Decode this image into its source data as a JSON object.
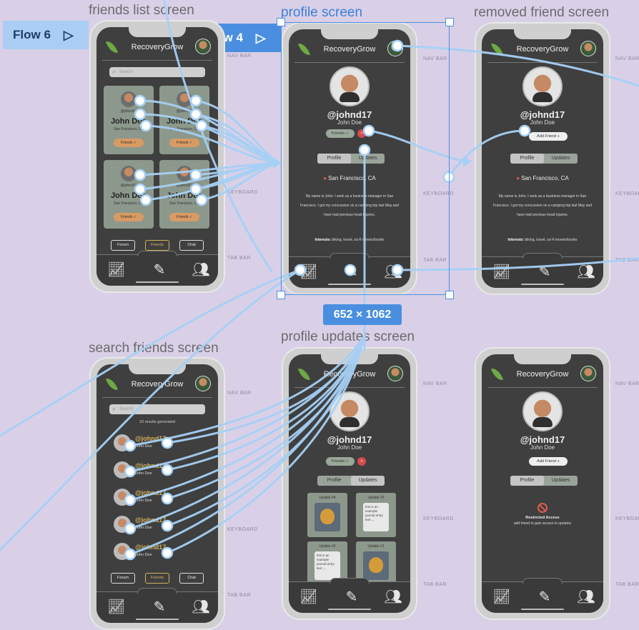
{
  "app": {
    "name": "RecoveryGrow"
  },
  "frames": {
    "friends_list": "friends list screen",
    "profile": "profile screen",
    "removed_friend": "removed friend screen",
    "search_friends": "search friends screen",
    "profile_updates": "profile updates screen"
  },
  "flows": {
    "flow6": "Flow 6",
    "flow4": "Flow 4"
  },
  "selection": {
    "dimensions": "652 × 1062"
  },
  "side_labels": {
    "nav_bar": "NAV BAR",
    "keyboard": "KEYBOARD",
    "tab_bar": "TAB BAR"
  },
  "search": {
    "placeholder": "Search",
    "results": "10 results generated"
  },
  "friend_card": {
    "handle": "@johnd17",
    "name": "John Doe",
    "location": "San Francisco, CA",
    "button": "Friends ✓"
  },
  "bottom_nav": {
    "forum": "Forum",
    "friends": "Friends",
    "chat": "Chat"
  },
  "profile": {
    "handle": "@johnd17",
    "name": "John Doe",
    "friends_pill": "Friends ✓",
    "remove": "×",
    "add_friend": "Add Friend +",
    "tab_profile": "Profile",
    "tab_updates": "Updates",
    "location": "San Francisco, CA",
    "bio": "My name is John. I work as a business manager in San Francisco. I got my concussion on a camping trip last May and have had previous head injuries.",
    "interests_label": "Interests:",
    "interests": "biking, travel, sci-fi movies/books"
  },
  "updates": {
    "u4": "Update #4",
    "u3": "Update #3",
    "u2": "Update #2",
    "u1": "Update #1",
    "journal": "this is an example journal entry text ..."
  },
  "restricted": {
    "title": "Restricted Access",
    "subtitle": "add friend to gain access to updates"
  },
  "tab_icons": {
    "progress": "chart-line-icon",
    "journal": "journal-icon",
    "community": "people-icon"
  }
}
